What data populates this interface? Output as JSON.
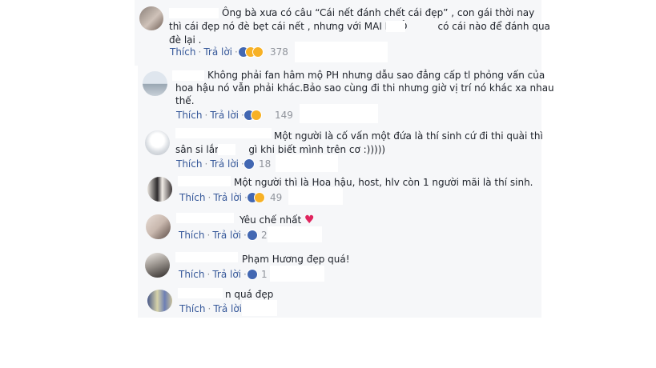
{
  "actions": {
    "like": "Thích",
    "reply": "Trả lời",
    "separator": "·"
  },
  "more_dots": "···",
  "comments": [
    {
      "lines": [
        "Ông bà xưa có câu “Cái nết đánh chết cái đẹp” , con gái thời nay",
        "thì cái đẹp nó đè bẹt cái nết , nhưng với MAI NGÔ          có cái nào để đánh qua",
        "đè lại ."
      ],
      "reactions": [
        "like",
        "haha",
        "wow"
      ],
      "count": "378"
    },
    {
      "lines": [
        "Không phải fan hâm mộ PH nhưng dẫu sao đẳng cấp tl phỏng vấn của",
        "hoa hậu nó vẫn phải khác.Bảo sao cùng đi thi nhưng giờ vị trí nó khác xa nhau",
        "thế."
      ],
      "reactions": [
        "like",
        "haha"
      ],
      "count": "149"
    },
    {
      "lines": [
        "Một người là cố vấn một đứa là thí sinh cứ đi thi quài thì",
        "sân si lắm        gì khi biết mình trên cơ :)))))"
      ],
      "reactions": [
        "like"
      ],
      "count": "18"
    },
    {
      "lines": [
        "Một người thì là Hoa hậu, host, hlv còn 1 người mãi là thí sinh."
      ],
      "reactions": [
        "like",
        "haha"
      ],
      "count": "49"
    },
    {
      "lines": [
        "Yêu chế nhất"
      ],
      "heart": "♥",
      "reactions": [
        "like"
      ],
      "count": "2"
    },
    {
      "lines": [
        "Phạm Hương đẹp quá!"
      ],
      "reactions": [
        "like"
      ],
      "count": "1"
    },
    {
      "lines": [
        "n quá đẹp"
      ],
      "reactions": [],
      "count": ""
    }
  ]
}
